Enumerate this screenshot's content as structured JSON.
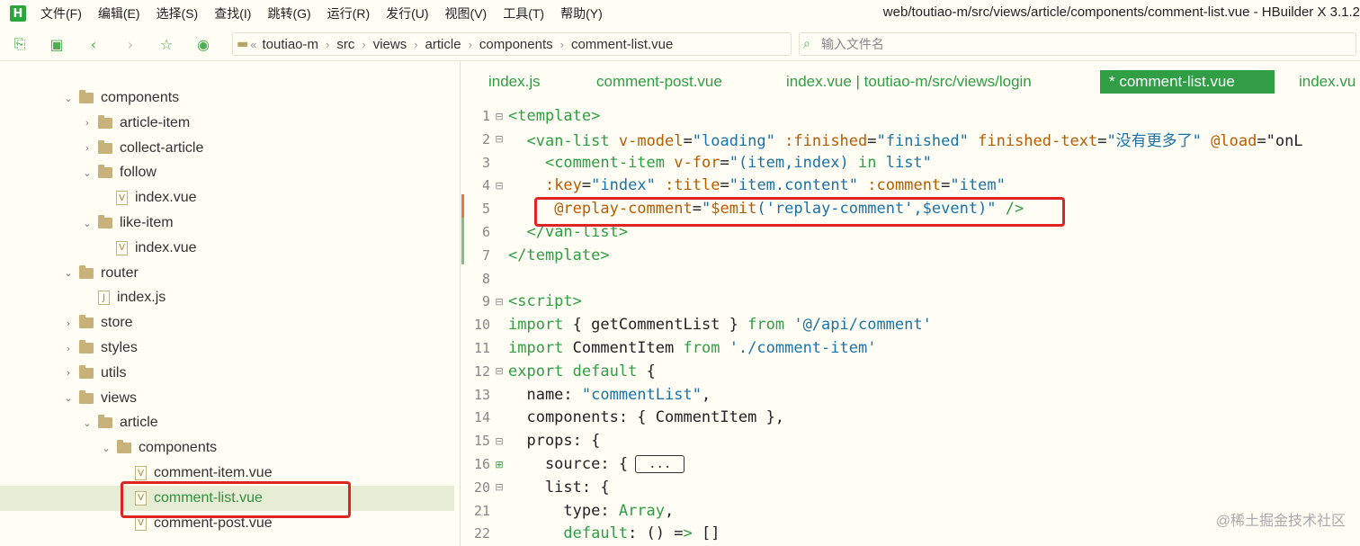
{
  "app": {
    "logo_letter": "H",
    "window_title": "web/toutiao-m/src/views/article/components/comment-list.vue - HBuilder X 3.1.2",
    "menu": [
      "文件(F)",
      "编辑(E)",
      "选择(S)",
      "查找(I)",
      "跳转(G)",
      "运行(R)",
      "发行(U)",
      "视图(V)",
      "工具(T)",
      "帮助(Y)"
    ]
  },
  "toolbar": {
    "icons": [
      "new-file-icon",
      "save-icon",
      "back-icon",
      "forward-icon",
      "star-icon",
      "run-icon"
    ],
    "breadcrumb": [
      "toutiao-m",
      "src",
      "views",
      "article",
      "components",
      "comment-list.vue"
    ],
    "breadcrumb_prefix": "«",
    "file_search_placeholder": "输入文件名"
  },
  "sidebar": {
    "items": [
      {
        "label": "components",
        "type": "folder",
        "expanded": true
      },
      {
        "label": "article-item",
        "type": "folder",
        "expanded": false
      },
      {
        "label": "collect-article",
        "type": "folder",
        "expanded": false
      },
      {
        "label": "follow",
        "type": "folder",
        "expanded": true
      },
      {
        "label": "index.vue",
        "type": "vue-file"
      },
      {
        "label": "like-item",
        "type": "folder",
        "expanded": true
      },
      {
        "label": "index.vue",
        "type": "vue-file"
      },
      {
        "label": "router",
        "type": "folder",
        "expanded": true
      },
      {
        "label": "index.js",
        "type": "js-file"
      },
      {
        "label": "store",
        "type": "folder",
        "expanded": false
      },
      {
        "label": "styles",
        "type": "folder",
        "expanded": false
      },
      {
        "label": "utils",
        "type": "folder",
        "expanded": false
      },
      {
        "label": "views",
        "type": "folder",
        "expanded": true
      },
      {
        "label": "article",
        "type": "folder",
        "expanded": true
      },
      {
        "label": "components",
        "type": "folder",
        "expanded": true
      },
      {
        "label": "comment-item.vue",
        "type": "vue-file"
      },
      {
        "label": "comment-list.vue",
        "type": "vue-file",
        "selected": true
      },
      {
        "label": "comment-post.vue",
        "type": "vue-file"
      }
    ]
  },
  "editor": {
    "tabs": [
      {
        "label": "index.js",
        "active": false
      },
      {
        "label": "comment-post.vue",
        "active": false
      },
      {
        "label": "index.vue | toutiao-m/src/views/login",
        "active": false
      },
      {
        "label": "* comment-list.vue",
        "active": true
      },
      {
        "label": "index.vu",
        "active": false
      }
    ],
    "collapsed_label": "...",
    "lines": [
      {
        "n": "1",
        "fold": "⊟",
        "text": "<template>"
      },
      {
        "n": "2",
        "fold": "⊟",
        "text": "  <van-list v-model=\"loading\" :finished=\"finished\" finished-text=\"没有更多了\" @load=\"onL"
      },
      {
        "n": "3",
        "fold": "",
        "text": "    <comment-item v-for=\"(item,index) in list\""
      },
      {
        "n": "4",
        "fold": "⊟",
        "text": "    :key=\"index\" :title=\"item.content\" :comment=\"item\""
      },
      {
        "n": "5",
        "fold": "",
        "text": "     @replay-comment=\"$emit('replay-comment',$event)\" />"
      },
      {
        "n": "6",
        "fold": "",
        "text": "  </van-list>"
      },
      {
        "n": "7",
        "fold": "",
        "text": "</template>"
      },
      {
        "n": "8",
        "fold": "",
        "text": ""
      },
      {
        "n": "9",
        "fold": "⊟",
        "text": "<script>"
      },
      {
        "n": "10",
        "fold": "",
        "text": "import { getCommentList } from '@/api/comment'"
      },
      {
        "n": "11",
        "fold": "",
        "text": "import CommentItem from './comment-item'"
      },
      {
        "n": "12",
        "fold": "⊟",
        "text": "export default {"
      },
      {
        "n": "13",
        "fold": "",
        "text": "  name: \"commentList\","
      },
      {
        "n": "14",
        "fold": "",
        "text": "  components: { CommentItem },"
      },
      {
        "n": "15",
        "fold": "⊟",
        "text": "  props: {"
      },
      {
        "n": "16",
        "fold": "⊞",
        "text": "    source: {"
      },
      {
        "n": "20",
        "fold": "⊟",
        "text": "    list: {"
      },
      {
        "n": "21",
        "fold": "",
        "text": "      type: Array,"
      },
      {
        "n": "22",
        "fold": "",
        "text": "      default: () => []"
      }
    ]
  },
  "watermark": "@稀土掘金技术社区",
  "colors": {
    "accent": "#2f9e44",
    "highlight_box": "#e02424",
    "background": "#fffdf4"
  }
}
